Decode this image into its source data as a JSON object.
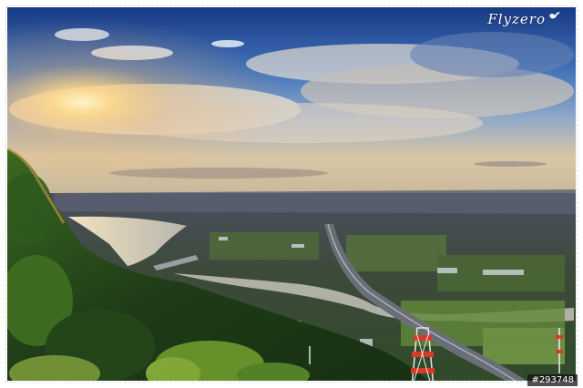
{
  "photo": {
    "subject": "sunset-over-river-valley-with-highway",
    "colors": {
      "sky_top": "#1d3f8c",
      "sky_mid": "#4b7bc0",
      "sun_glow": "#ffd98a",
      "horizon": "#e9c08a",
      "river": "#c9c2b4",
      "forest": "#1f3a1a",
      "foreground_green": "#5f8a2a",
      "tower_red": "#d83a2a"
    }
  },
  "watermark": {
    "text": "Flyzero",
    "icon": "bird-icon"
  },
  "image_id": {
    "text": "#293748"
  }
}
